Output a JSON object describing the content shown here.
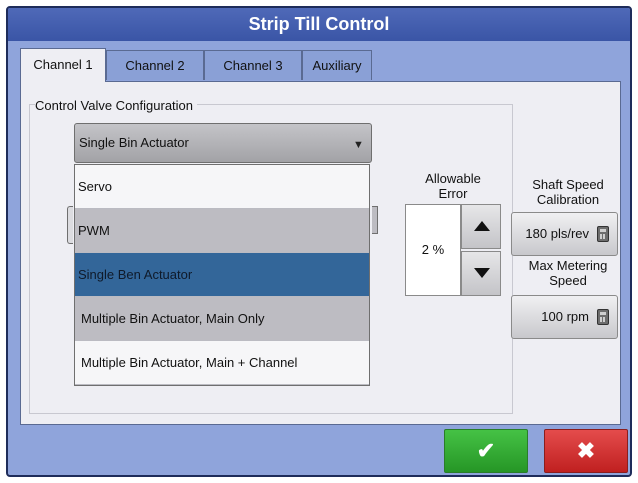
{
  "window": {
    "title": "Strip Till Control"
  },
  "tabs": [
    {
      "label": "Channel 1",
      "active": true
    },
    {
      "label": "Channel 2",
      "active": false
    },
    {
      "label": "Channel 3",
      "active": false
    },
    {
      "label": "Auxiliary",
      "active": false
    }
  ],
  "config": {
    "group_title": "Control Valve Configuration",
    "selected_value": "Single Bin Actuator",
    "options": [
      "Servo",
      "PWM",
      "Single Ben Actuator",
      "Multiple Bin Actuator, Main Only",
      "Multiple Bin Actuator, Main + Channel"
    ],
    "highlighted_option": "Single Ben Actuator"
  },
  "allowable_error": {
    "label": "Allowable Error",
    "value": "2 %"
  },
  "shaft_speed": {
    "label": "Shaft Speed Calibration",
    "value": "180 pls/rev"
  },
  "max_metering": {
    "label": "Max Metering Speed",
    "value": "100 rpm"
  },
  "actions": {
    "ok_symbol": "✔",
    "cancel_symbol": "✖"
  },
  "colors": {
    "title_bar": "#4f69b8",
    "ok": "#2fa62f",
    "cancel": "#d42f2f",
    "highlight": "#336699"
  },
  "icons": {
    "calculator": "calculator-icon",
    "dropdown": "dropdown-arrow-icon",
    "up": "arrow-up-icon",
    "down": "arrow-down-icon"
  }
}
